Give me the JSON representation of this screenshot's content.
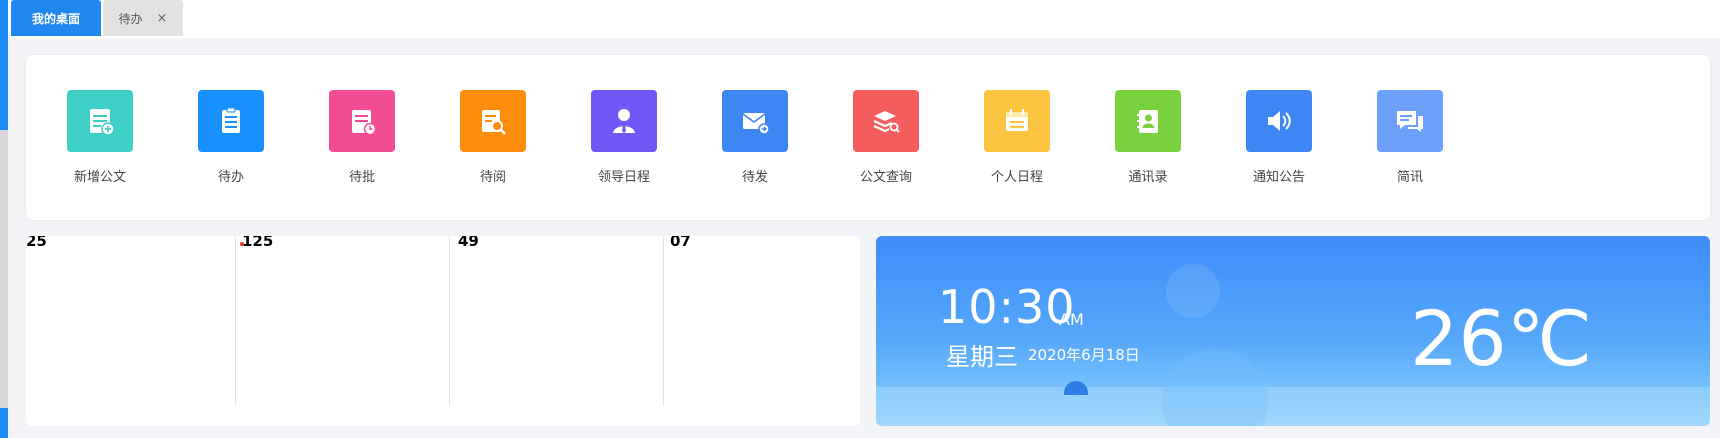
{
  "tabs": [
    {
      "label": "我的桌面",
      "active": true
    },
    {
      "label": "待办",
      "active": false,
      "close": "×"
    }
  ],
  "quick_links": [
    {
      "label": "新增公文",
      "color": "#3dcfc6",
      "icon": "new-document-icon"
    },
    {
      "label": "待办",
      "color": "#1890ff",
      "icon": "clipboard-icon"
    },
    {
      "label": "待批",
      "color": "#f04d95",
      "icon": "approve-document-icon"
    },
    {
      "label": "待阅",
      "color": "#fd8d0a",
      "icon": "read-document-icon"
    },
    {
      "label": "领导日程",
      "color": "#7357f6",
      "icon": "leader-icon"
    },
    {
      "label": "待发",
      "color": "#3f86f5",
      "icon": "send-mail-icon"
    },
    {
      "label": "公文查询",
      "color": "#f45d5d",
      "icon": "document-search-icon"
    },
    {
      "label": "个人日程",
      "color": "#fdc441",
      "icon": "calendar-icon"
    },
    {
      "label": "通讯录",
      "color": "#7ad13e",
      "icon": "contacts-icon"
    },
    {
      "label": "通知公告",
      "color": "#3f86f5",
      "icon": "speaker-icon"
    },
    {
      "label": "简讯",
      "color": "#6da0fb",
      "icon": "message-icon"
    }
  ],
  "calendar": {
    "columns": [
      "25",
      "125",
      "49",
      "07"
    ]
  },
  "weather": {
    "time": "10:30",
    "ampm": "AM",
    "weekday": "星期三",
    "date": "2020年6月18日",
    "temperature": "26℃"
  }
}
